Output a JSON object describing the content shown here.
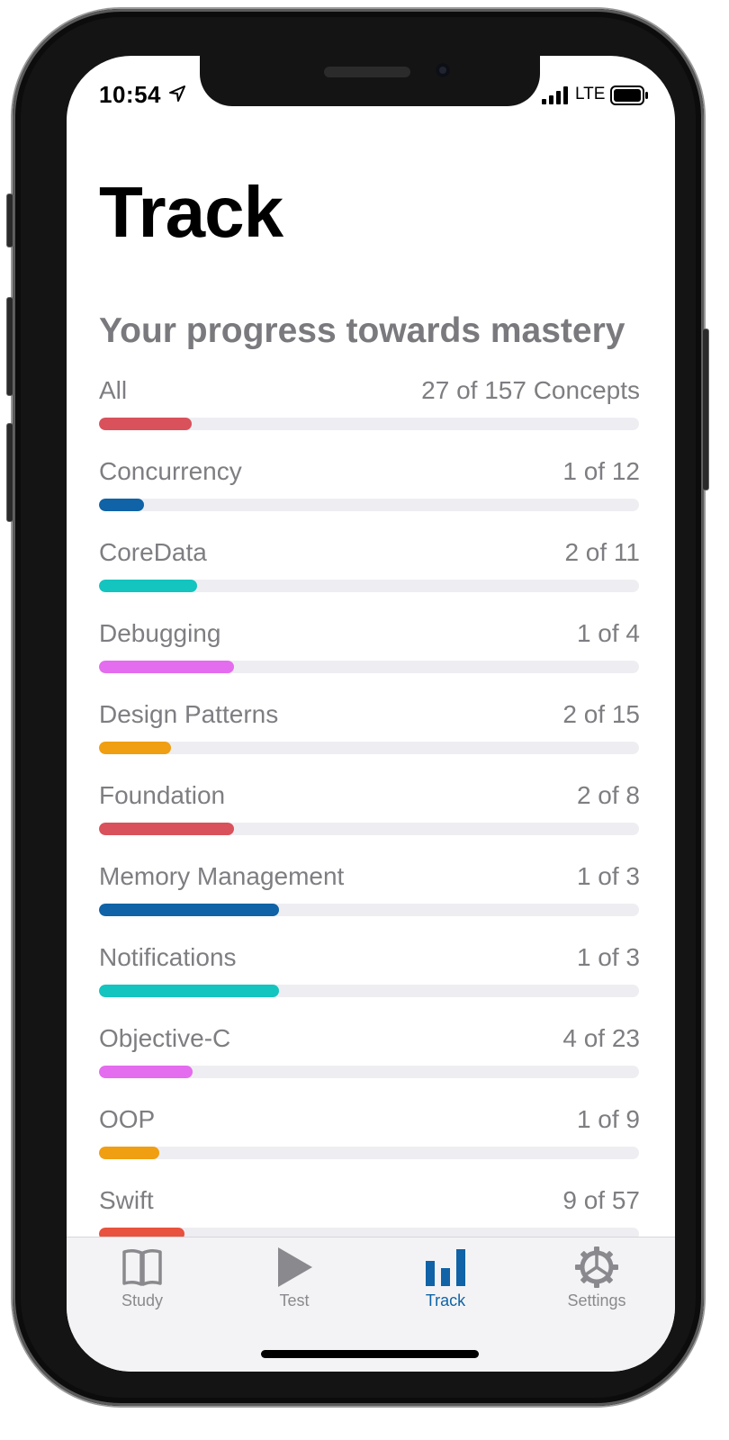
{
  "status_bar": {
    "time": "10:54",
    "network": "LTE"
  },
  "header": {
    "title": "Track",
    "subtitle": "Your progress towards mastery"
  },
  "progress": [
    {
      "label": "All",
      "count": "27 of 157 Concepts",
      "fraction": 0.172,
      "color": "#d9515b"
    },
    {
      "label": "Concurrency",
      "count": "1 of 12",
      "fraction": 0.083,
      "color": "#0f63a6"
    },
    {
      "label": "CoreData",
      "count": "2 of 11",
      "fraction": 0.182,
      "color": "#14c4bf"
    },
    {
      "label": "Debugging",
      "count": "1 of 4",
      "fraction": 0.25,
      "color": "#e46cee"
    },
    {
      "label": "Design Patterns",
      "count": "2 of 15",
      "fraction": 0.133,
      "color": "#f09e12"
    },
    {
      "label": "Foundation",
      "count": "2 of 8",
      "fraction": 0.25,
      "color": "#d9515b"
    },
    {
      "label": "Memory Management",
      "count": "1 of 3",
      "fraction": 0.333,
      "color": "#0f63a6"
    },
    {
      "label": "Notifications",
      "count": "1 of 3",
      "fraction": 0.333,
      "color": "#14c4bf"
    },
    {
      "label": "Objective-C",
      "count": "4 of 23",
      "fraction": 0.174,
      "color": "#e46cee"
    },
    {
      "label": "OOP",
      "count": "1 of 9",
      "fraction": 0.111,
      "color": "#f09e12"
    },
    {
      "label": "Swift",
      "count": "9 of 57",
      "fraction": 0.158,
      "color": "#e8523e"
    }
  ],
  "tab_bar": {
    "tabs": [
      {
        "label": "Study",
        "icon": "book-icon",
        "active": false
      },
      {
        "label": "Test",
        "icon": "play-icon",
        "active": false
      },
      {
        "label": "Track",
        "icon": "bar-chart-icon",
        "active": true
      },
      {
        "label": "Settings",
        "icon": "gear-icon",
        "active": false
      }
    ],
    "active_color": "#0f63a6",
    "inactive_color": "#8a8a8e"
  }
}
